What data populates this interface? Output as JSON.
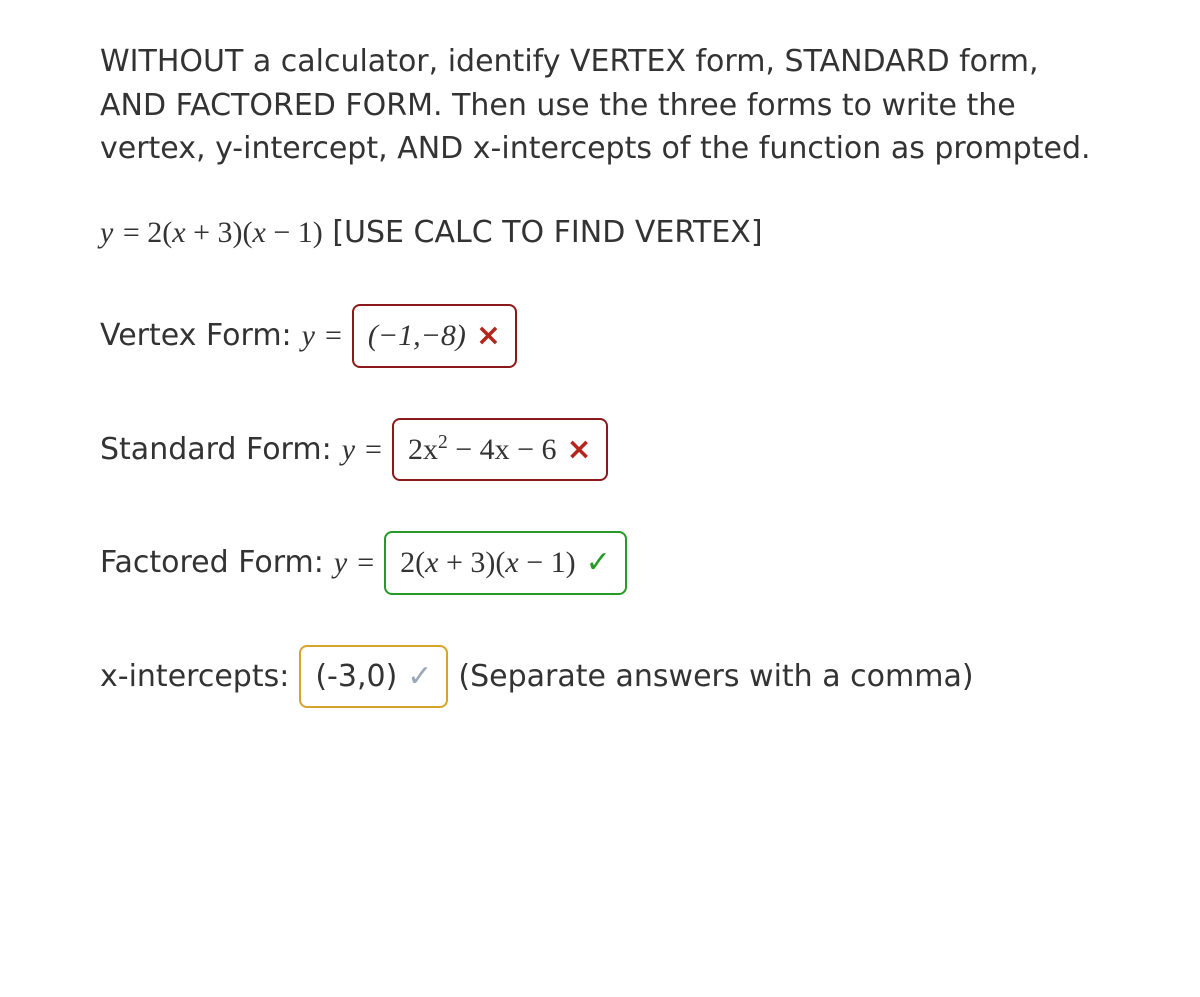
{
  "instructions": "WITHOUT a calculator, identify VERTEX form, STANDARD form, AND FACTORED FORM. Then use the three forms to write the vertex, y-intercept, AND x-intercepts of the function as prompted.",
  "given_equation_prefix": "y = 2(x + 3)(x − 1) ",
  "given_equation_note": "[USE CALC TO FIND VERTEX]",
  "rows": {
    "vertex": {
      "label": "Vertex Form: ",
      "y_equals": "y =",
      "answer": "(−1,−8)",
      "status": "incorrect",
      "mark": "×"
    },
    "standard": {
      "label": "Standard Form: ",
      "y_equals": "y =",
      "answer_pre": "2x",
      "answer_exp": "2",
      "answer_post": " − 4x − 6",
      "status": "incorrect",
      "mark": "×"
    },
    "factored": {
      "label": "Factored Form: ",
      "y_equals": "y =",
      "answer": "2(x + 3)(x − 1)",
      "status": "correct",
      "mark": "✓"
    },
    "xint": {
      "label": "x-intercepts: ",
      "answer": "(-3,0)",
      "mark": "✓",
      "status": "partial",
      "hint": "(Separate answers with a comma)"
    }
  }
}
